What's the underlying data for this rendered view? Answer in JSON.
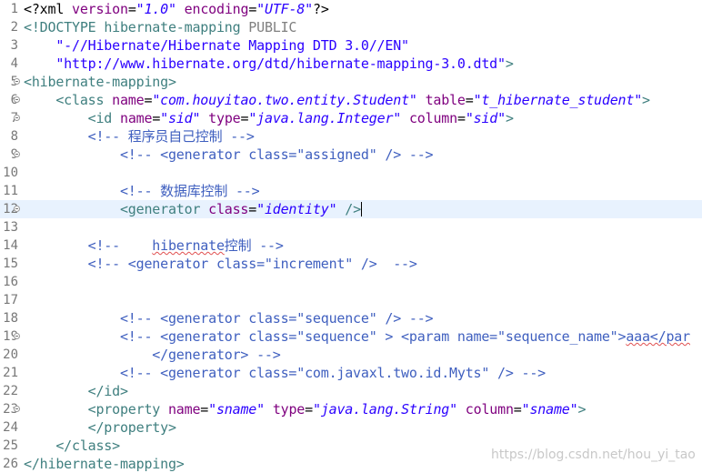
{
  "line_numbers": [
    "1",
    "2",
    "3",
    "4",
    "5",
    "6",
    "7",
    "8",
    "9",
    "10",
    "11",
    "12",
    "13",
    "14",
    "15",
    "16",
    "17",
    "18",
    "19",
    "20",
    "21",
    "22",
    "23",
    "24",
    "25",
    "26"
  ],
  "folded_lines": [
    "5",
    "6",
    "7",
    "9",
    "12",
    "19",
    "23"
  ],
  "current_line": "12",
  "lines": [
    [
      [
        "c-txt",
        "<?xml "
      ],
      [
        "c-attr",
        "version"
      ],
      [
        "c-txt",
        "="
      ],
      [
        "c-str",
        "\"1.0\""
      ],
      [
        "c-txt",
        " "
      ],
      [
        "c-attr",
        "encoding"
      ],
      [
        "c-txt",
        "="
      ],
      [
        "c-str",
        "\"UTF-8\""
      ],
      [
        "c-txt",
        "?>"
      ]
    ],
    [
      [
        "c-tag",
        "<!DOCTYPE "
      ],
      [
        "c-tag",
        "hibernate-mapping "
      ],
      [
        "c-kw",
        "PUBLIC"
      ]
    ],
    [
      [
        "c-dtd",
        "    \"-//Hibernate/Hibernate Mapping DTD 3.0//EN\""
      ]
    ],
    [
      [
        "c-dtd",
        "    \"http://www.hibernate.org/dtd/hibernate-mapping-3.0.dtd\""
      ],
      [
        "c-tag",
        ">"
      ]
    ],
    [
      [
        "c-tag",
        "<hibernate-mapping>"
      ]
    ],
    [
      [
        "c-tag",
        "    <class "
      ],
      [
        "c-attr",
        "name"
      ],
      [
        "c-txt",
        "="
      ],
      [
        "c-str",
        "\"com.houyitao.two.entity.Student\""
      ],
      [
        "c-txt",
        " "
      ],
      [
        "c-attr",
        "table"
      ],
      [
        "c-txt",
        "="
      ],
      [
        "c-str",
        "\"t_hibernate_student\""
      ],
      [
        "c-tag",
        ">"
      ]
    ],
    [
      [
        "c-tag",
        "        <id "
      ],
      [
        "c-attr",
        "name"
      ],
      [
        "c-txt",
        "="
      ],
      [
        "c-str",
        "\"sid\""
      ],
      [
        "c-txt",
        " "
      ],
      [
        "c-attr",
        "type"
      ],
      [
        "c-txt",
        "="
      ],
      [
        "c-str",
        "\"java.lang.Integer\""
      ],
      [
        "c-txt",
        " "
      ],
      [
        "c-attr",
        "column"
      ],
      [
        "c-txt",
        "="
      ],
      [
        "c-str",
        "\"sid\""
      ],
      [
        "c-tag",
        ">"
      ]
    ],
    [
      [
        "c-com",
        "        <!-- 程序员自己控制 -->"
      ]
    ],
    [
      [
        "c-com",
        "            <!-- <generator class=\"assigned\" /> -->"
      ]
    ],
    [],
    [
      [
        "c-com",
        "            <!-- 数据库控制 -->"
      ]
    ],
    [
      [
        "c-tag",
        "            <generator "
      ],
      [
        "c-attr",
        "class"
      ],
      [
        "c-txt",
        "="
      ],
      [
        "c-str",
        "\"identity\""
      ],
      [
        "c-txt",
        " "
      ],
      [
        "c-tag",
        "/>"
      ]
    ],
    [],
    [
      [
        "c-com",
        "        <!--    "
      ],
      [
        "c-com squig",
        "hibernate"
      ],
      [
        "c-com",
        "控制 -->"
      ]
    ],
    [
      [
        "c-com",
        "        <!-- <generator class=\"increment\" />  -->"
      ]
    ],
    [],
    [],
    [
      [
        "c-com",
        "            <!-- <generator class=\"sequence\" /> -->"
      ]
    ],
    [
      [
        "c-com",
        "            <!-- <generator class=\"sequence\" > <param name=\"sequence_name\">"
      ],
      [
        "c-com squig",
        "aaa</par"
      ]
    ],
    [
      [
        "c-com",
        "                </generator> -->"
      ]
    ],
    [
      [
        "c-com",
        "            <!-- <generator class=\"com.javaxl.two.id.Myts\" /> -->"
      ]
    ],
    [
      [
        "c-tag",
        "        </id>"
      ]
    ],
    [
      [
        "c-tag",
        "        <property "
      ],
      [
        "c-attr",
        "name"
      ],
      [
        "c-txt",
        "="
      ],
      [
        "c-str",
        "\"sname\""
      ],
      [
        "c-txt",
        " "
      ],
      [
        "c-attr",
        "type"
      ],
      [
        "c-txt",
        "="
      ],
      [
        "c-str",
        "\"java.lang.String\""
      ],
      [
        "c-txt",
        " "
      ],
      [
        "c-attr",
        "column"
      ],
      [
        "c-txt",
        "="
      ],
      [
        "c-str",
        "\"sname\""
      ],
      [
        "c-tag",
        ">"
      ]
    ],
    [
      [
        "c-tag",
        "        </property>"
      ]
    ],
    [
      [
        "c-tag",
        "    </class>"
      ]
    ],
    [
      [
        "c-tag",
        "</hibernate-mapping>"
      ]
    ]
  ],
  "watermark": "https://blog.csdn.net/hou_yi_tao"
}
